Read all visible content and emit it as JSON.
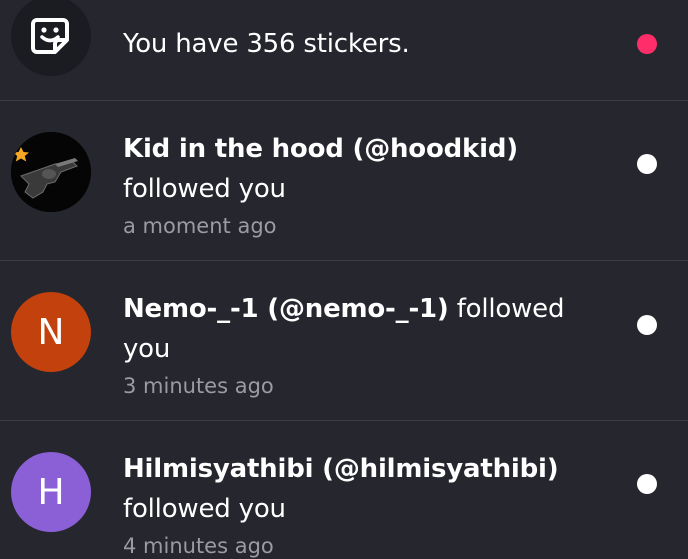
{
  "notifications": [
    {
      "icon": "sticker-icon",
      "text": "You have 356 stickers.",
      "dot_color": "#ff2e6a"
    },
    {
      "avatar": "photo-avatar",
      "name": "Kid in the hood (@hoodkid)",
      "action": "followed you",
      "time": "a moment ago",
      "dot_color": "#ffffff"
    },
    {
      "avatar_letter": "N",
      "avatar_color": "#c2410c",
      "name": "Nemo-_-1 (@nemo-_-1)",
      "action": "followed you",
      "time": "3 minutes ago",
      "dot_color": "#ffffff"
    },
    {
      "avatar_letter": "H",
      "avatar_color": "#8b5fd6",
      "name": "Hilmisyathibi (@hilmisyathibi)",
      "action": "followed you",
      "time": "4 minutes ago",
      "dot_color": "#ffffff"
    }
  ]
}
